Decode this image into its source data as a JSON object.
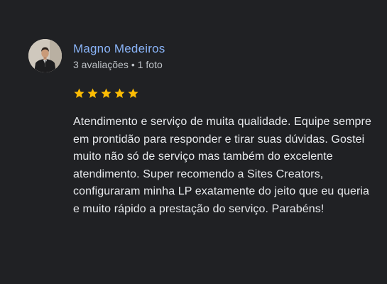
{
  "review": {
    "author_name": "Magno Medeiros",
    "reviews_count": "3 avaliações",
    "separator": "•",
    "photos_count": "1 foto",
    "rating": 5,
    "rating_max": 5,
    "text": "Atendimento e serviço de muita qualidade. Equipe sempre em prontidão para responder e tirar suas dúvidas. Gostei muito não só de serviço mas também do excelente atendimento. Super recomendo a Sites Creators, configuraram minha LP exatamente do jeito que eu queria e muito rápido a prestação do serviço. Parabéns!"
  },
  "colors": {
    "background": "#202124",
    "author": "#8ab4f8",
    "meta": "#bdc1c6",
    "text": "#e8eaed",
    "star": "#fbbc04"
  },
  "icons": {
    "avatar": "profile-photo",
    "star": "star-icon"
  }
}
